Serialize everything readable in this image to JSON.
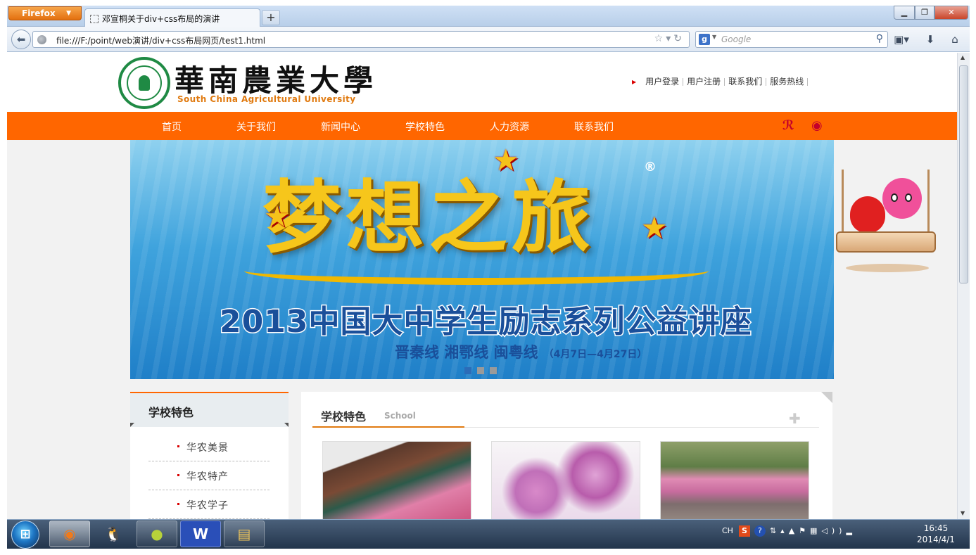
{
  "browser": {
    "app_button": "Firefox",
    "tab_title": "邓宣桐关于div+css布局的演讲",
    "new_tab_label": "+",
    "url": "file:///F:/point/web演讲/div+css布局网页/test1.html",
    "search_placeholder": "Google",
    "window_controls": {
      "minimize": "▁",
      "maximize": "❐",
      "close": "✕"
    }
  },
  "site": {
    "logo_cn": "華南農業大學",
    "logo_en": "South China Agricultural University",
    "top_links": [
      "用户登录",
      "用户注册",
      "联系我们",
      "服务热线"
    ],
    "nav": [
      "首页",
      "关于我们",
      "新闻中心",
      "学校特色",
      "人力资源",
      "联系我们"
    ],
    "social_icons": [
      "tencent-weibo-icon",
      "sina-weibo-icon"
    ]
  },
  "banner": {
    "headline": "梦想之旅",
    "registered_mark": "®",
    "subtitle": "2013中国大中学生励志系列公益讲座",
    "routes": "晋秦线  湘鄂线  闽粤线",
    "dates": "（4月7日—4月27日）",
    "slide_count": 3,
    "active_slide": 1
  },
  "sidebar": {
    "title": "学校特色",
    "items": [
      "华农美景",
      "华农特产",
      "华农学子"
    ]
  },
  "content": {
    "title": "学校特色",
    "title_en": "School",
    "more_icon": "plus-icon"
  },
  "taskbar": {
    "apps": [
      "firefox-icon",
      "qq-icon",
      "chrome-like-icon",
      "wps-writer-icon",
      "explorer-icon"
    ],
    "tray_lang": "CH",
    "time": "16:45",
    "date": "2014/4/1"
  },
  "colors": {
    "accent_orange": "#ff6600",
    "logo_green": "#1f8a44",
    "link_red": "#d90000"
  }
}
